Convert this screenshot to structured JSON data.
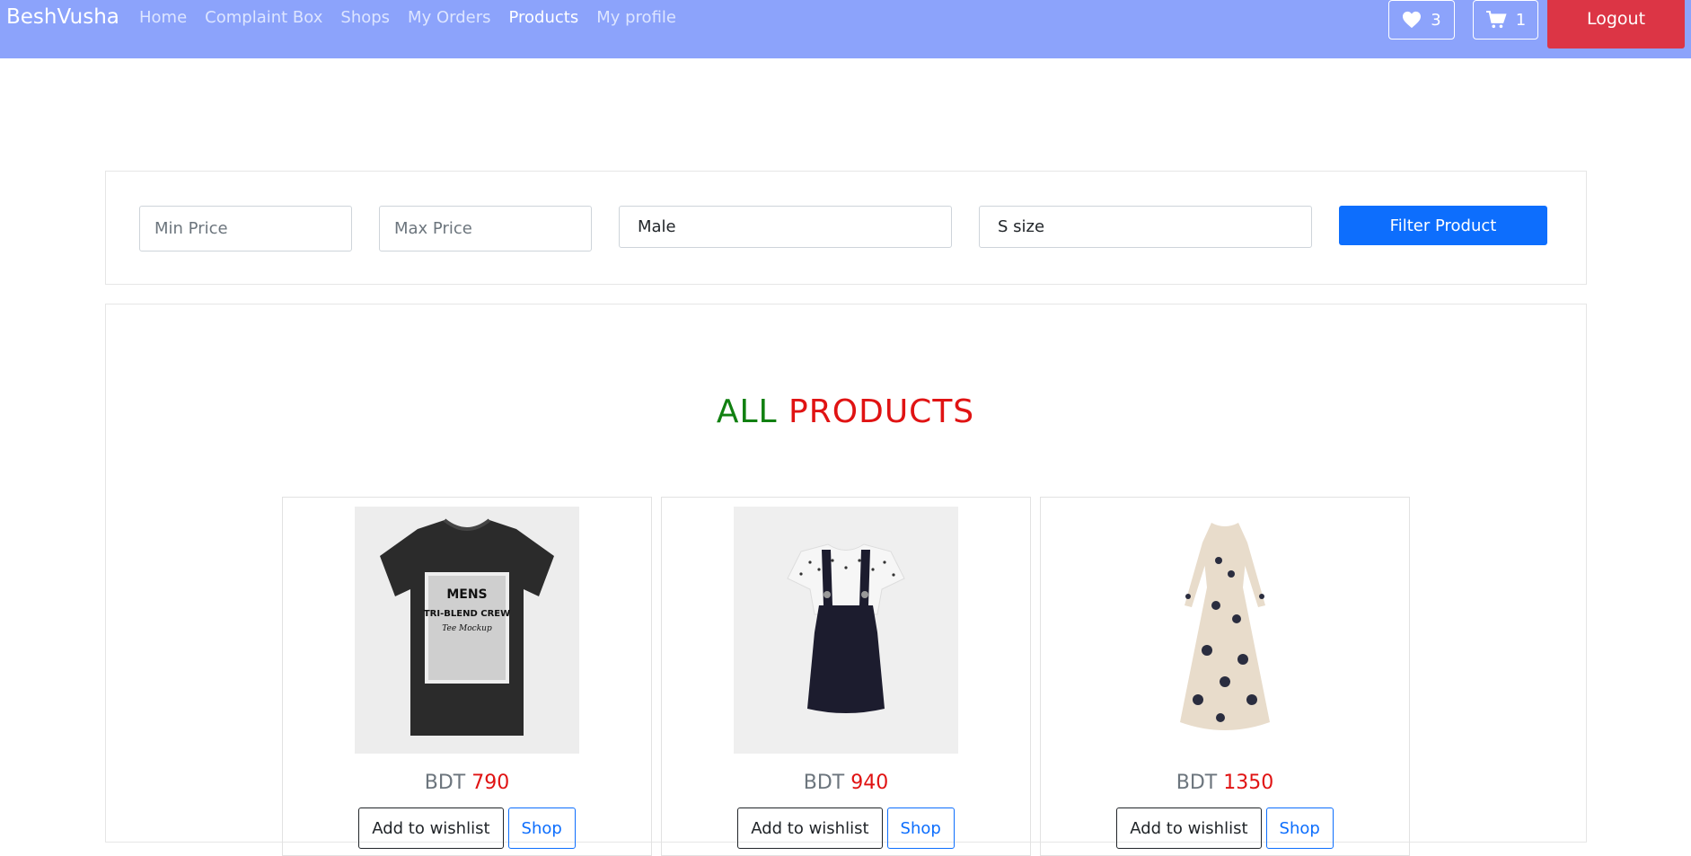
{
  "navbar": {
    "brand": "BeshVusha",
    "links": [
      {
        "label": "Home"
      },
      {
        "label": "Complaint Box"
      },
      {
        "label": "Shops"
      },
      {
        "label": "My Orders"
      },
      {
        "label": "Products",
        "active": true
      },
      {
        "label": "My profile"
      }
    ],
    "wishlist_count": "3",
    "cart_count": "1",
    "logout_label": "Logout"
  },
  "filter": {
    "min_price_placeholder": "Min Price",
    "max_price_placeholder": "Max Price",
    "gender_selected": "Male",
    "size_selected": "S size",
    "button_label": "Filter Product"
  },
  "products_section": {
    "heading_part1": "ALL",
    "heading_part2": "PRODUCTS",
    "items": [
      {
        "image": "black-tshirt-image",
        "currency": "BDT",
        "price": "790",
        "wishlist_label": "Add to wishlist",
        "shop_label": "Shop"
      },
      {
        "image": "kids-pinafore-dress-image",
        "currency": "BDT",
        "price": "940",
        "wishlist_label": "Add to wishlist",
        "shop_label": "Shop"
      },
      {
        "image": "floral-maxi-dress-image",
        "currency": "BDT",
        "price": "1350",
        "wishlist_label": "Add to wishlist",
        "shop_label": "Shop"
      }
    ]
  },
  "colors": {
    "navbar_bg": "#8ca3fb",
    "logout_bg": "#dc3545",
    "primary": "#0d6efd",
    "heading_green": "#118011",
    "heading_red": "#e01313"
  }
}
